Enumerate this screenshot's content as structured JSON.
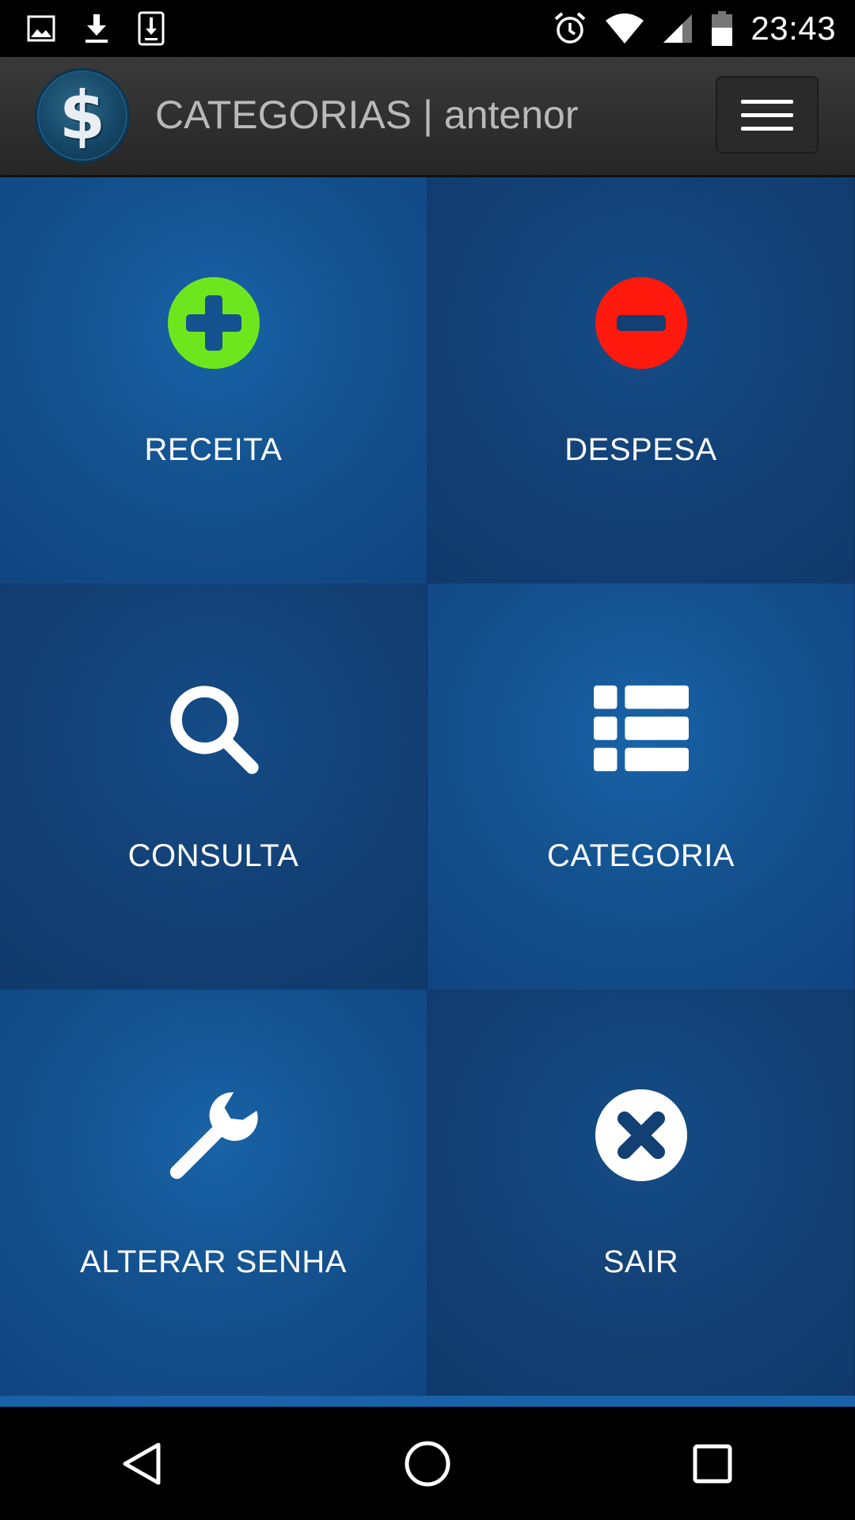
{
  "status_bar": {
    "time": "23:43",
    "left_icons": [
      "image-icon",
      "download-icon",
      "download-box-icon"
    ],
    "right_icons": [
      "alarm-icon",
      "wifi-icon",
      "signal-icon",
      "battery-icon"
    ]
  },
  "header": {
    "logo_symbol": "$",
    "title": "CATEGORIAS | antenor",
    "menu_icon": "hamburger-menu-icon"
  },
  "tiles": [
    {
      "label": "RECEITA",
      "icon": "plus-circle-icon",
      "icon_color": "#6ee61e"
    },
    {
      "label": "DESPESA",
      "icon": "minus-circle-icon",
      "icon_color": "#ff1a0d"
    },
    {
      "label": "CONSULTA",
      "icon": "search-icon",
      "icon_color": "#ffffff"
    },
    {
      "label": "CATEGORIA",
      "icon": "list-icon",
      "icon_color": "#ffffff"
    },
    {
      "label": "ALTERAR SENHA",
      "icon": "wrench-icon",
      "icon_color": "#ffffff"
    },
    {
      "label": "SAIR",
      "icon": "close-circle-icon",
      "icon_color": "#ffffff"
    }
  ],
  "nav_bar": {
    "buttons": [
      "back-triangle-icon",
      "home-circle-icon",
      "recents-square-icon"
    ]
  },
  "colors": {
    "tile_blue_light": "#14528f",
    "tile_blue_dark": "#123f74",
    "accent_strip": "#1a62a8",
    "header_bg": "#2f2f2f"
  }
}
